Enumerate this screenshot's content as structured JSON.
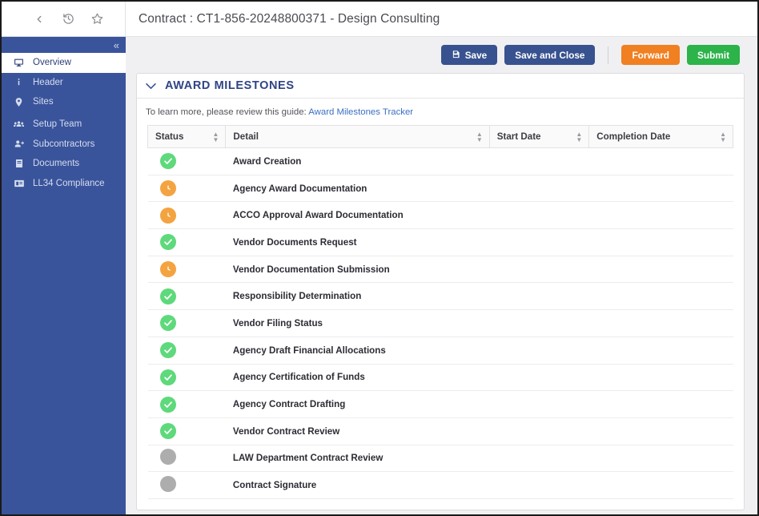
{
  "topbar": {
    "nav_icons": [
      "back-icon",
      "history-icon",
      "favorite-star-icon"
    ],
    "title": "Contract : CT1-856-20248800371 - Design Consulting"
  },
  "sidebar": {
    "collapse_label": "«",
    "accent_color": "#3a549c",
    "items": [
      {
        "label": "Overview",
        "icon": "monitor-icon",
        "active": true
      },
      {
        "label": "Header",
        "icon": "info-icon",
        "active": false
      },
      {
        "label": "Sites",
        "icon": "location-pin-icon",
        "active": false
      },
      {
        "label": "Setup Team",
        "icon": "users-group-icon",
        "active": false
      },
      {
        "label": "Subcontractors",
        "icon": "user-add-icon",
        "active": false
      },
      {
        "label": "Documents",
        "icon": "document-icon",
        "active": false
      },
      {
        "label": "LL34 Compliance",
        "icon": "id-card-icon",
        "active": false
      }
    ]
  },
  "toolbar": {
    "save_label": "Save",
    "save_and_close_label": "Save and Close",
    "forward_label": "Forward",
    "submit_label": "Submit",
    "colors": {
      "navy": "#38528f",
      "orange": "#f08021",
      "green": "#2cb34a"
    }
  },
  "card": {
    "title": "AWARD MILESTONES",
    "guide_text": "To learn more, please review this guide:",
    "guide_link": "Award Milestones Tracker"
  },
  "table": {
    "columns": [
      "Status",
      "Detail",
      "Start Date",
      "Completion Date"
    ],
    "rows": [
      {
        "status": "complete",
        "detail": "Award Creation",
        "start_date": "",
        "completion_date": ""
      },
      {
        "status": "pending",
        "detail": "Agency Award Documentation",
        "start_date": "",
        "completion_date": ""
      },
      {
        "status": "pending",
        "detail": "ACCO Approval Award Documentation",
        "start_date": "",
        "completion_date": ""
      },
      {
        "status": "complete",
        "detail": "Vendor Documents Request",
        "start_date": "",
        "completion_date": ""
      },
      {
        "status": "pending",
        "detail": "Vendor Documentation Submission",
        "start_date": "",
        "completion_date": ""
      },
      {
        "status": "complete",
        "detail": "Responsibility Determination",
        "start_date": "",
        "completion_date": ""
      },
      {
        "status": "complete",
        "detail": "Vendor Filing Status",
        "start_date": "",
        "completion_date": ""
      },
      {
        "status": "complete",
        "detail": "Agency Draft Financial Allocations",
        "start_date": "",
        "completion_date": ""
      },
      {
        "status": "complete",
        "detail": "Agency Certification of Funds",
        "start_date": "",
        "completion_date": ""
      },
      {
        "status": "complete",
        "detail": "Agency Contract Drafting",
        "start_date": "",
        "completion_date": ""
      },
      {
        "status": "complete",
        "detail": "Vendor Contract Review",
        "start_date": "",
        "completion_date": ""
      },
      {
        "status": "none",
        "detail": "LAW Department Contract Review",
        "start_date": "",
        "completion_date": ""
      },
      {
        "status": "none",
        "detail": "Contract Signature",
        "start_date": "",
        "completion_date": ""
      }
    ],
    "status_colors": {
      "complete": "#5ed97b",
      "pending": "#f4a341",
      "none": "#adadad"
    }
  }
}
